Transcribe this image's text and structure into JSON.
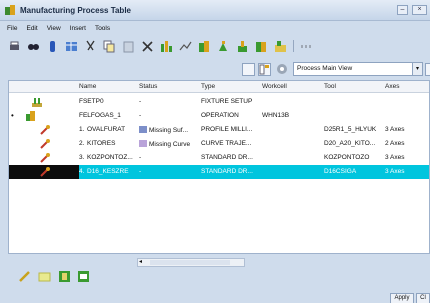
{
  "window": {
    "title": "Manufacturing Process Table"
  },
  "menu": [
    "File",
    "Edit",
    "View",
    "Insert",
    "Tools"
  ],
  "view_select": {
    "value": "Process Main View"
  },
  "columns": [
    "Name",
    "Status",
    "Type",
    "Workcell",
    "Tool",
    "Axes"
  ],
  "rows": [
    {
      "num": "",
      "name": "FSETP0",
      "status": "-",
      "type": "FIXTURE SETUP",
      "workcell": "",
      "tool": "",
      "axes": ""
    },
    {
      "num": "",
      "name": "FELFOGAS_1",
      "status": "-",
      "type": "OPERATION",
      "workcell": "WHN13B",
      "tool": "",
      "axes": ""
    },
    {
      "num": "1.",
      "name": "OVALFURAT",
      "status": "Missing Suf...",
      "type": "PROFILE MILLI...",
      "workcell": "",
      "tool": "D25R1_5_HLYUK",
      "axes": "3 Axes"
    },
    {
      "num": "2.",
      "name": "KITORES",
      "status": "Missing Curve",
      "type": "CURVE TRAJE...",
      "workcell": "",
      "tool": "D20_A20_KITO...",
      "axes": "2 Axes"
    },
    {
      "num": "3.",
      "name": "KOZPONTOZ...",
      "status": "-",
      "type": "STANDARD DR...",
      "workcell": "",
      "tool": "KOZPONTOZO",
      "axes": "3 Axes"
    },
    {
      "num": "4.",
      "name": "D16_KESZRE",
      "status": "-",
      "type": "STANDARD DR...",
      "workcell": "",
      "tool": "D16CSIGA",
      "axes": "3 Axes"
    }
  ],
  "selected_row": 5,
  "buttons": {
    "apply": "Apply",
    "close": "Cl"
  }
}
